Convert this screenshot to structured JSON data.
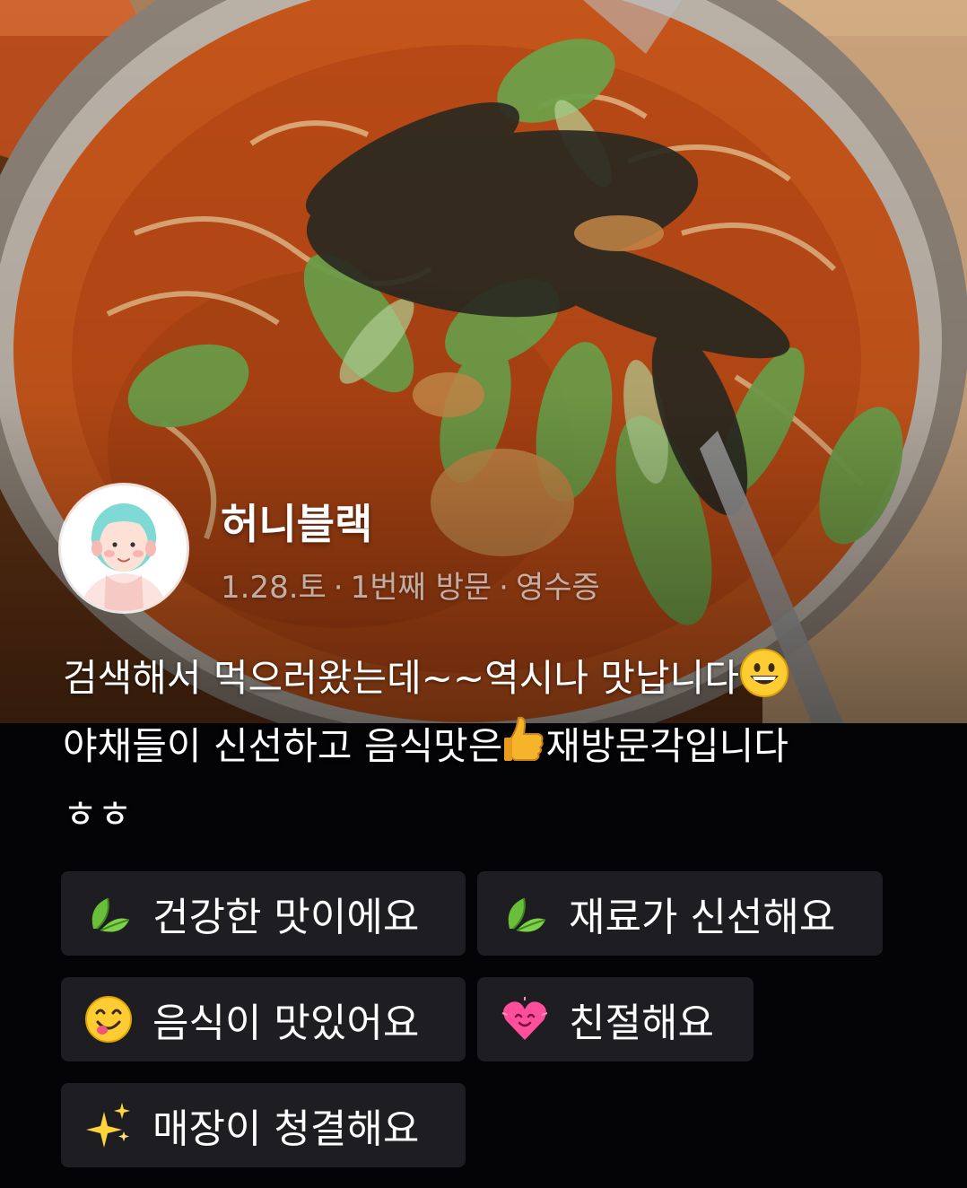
{
  "photo": {
    "icon": "food-photo"
  },
  "profile": {
    "username": "허니블랙",
    "date": "1.28.토",
    "visit": "1번째 방문",
    "verification": "영수증",
    "separator": "·"
  },
  "review": {
    "line1": "검색해서 먹으러왔는데~~역시나 맛납니다",
    "line2_a": "야채들이 신선하고 음식맛은",
    "line2_b": "재방문각입니다",
    "line3": "ㅎㅎ"
  },
  "tags": [
    {
      "label": "건강한 맛이에요",
      "icon": "leaf-icon"
    },
    {
      "label": "재료가 신선해요",
      "icon": "leaf-icon"
    },
    {
      "label": "음식이 맛있어요",
      "icon": "yum-face-icon"
    },
    {
      "label": "친절해요",
      "icon": "smiling-heart-icon"
    },
    {
      "label": "매장이 청결해요",
      "icon": "sparkles-icon"
    }
  ],
  "colors": {
    "background": "#050507",
    "tag_background": "#1e1e22",
    "text": "#ffffff",
    "meta_text": "#9a9a9a"
  }
}
